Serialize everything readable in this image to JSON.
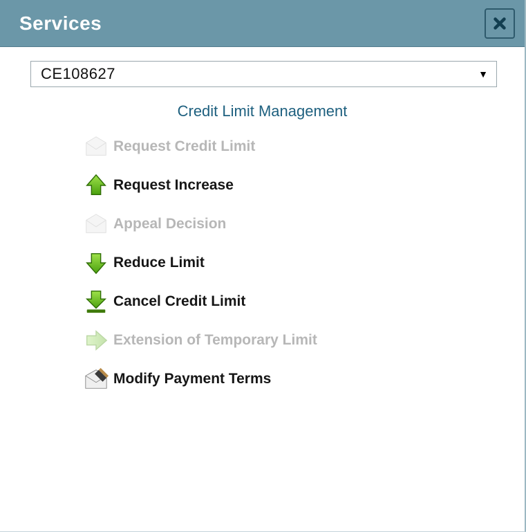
{
  "header": {
    "title": "Services"
  },
  "selector": {
    "value": "CE108627"
  },
  "section": {
    "title": "Credit Limit Management"
  },
  "items": [
    {
      "label": "Request Credit Limit",
      "icon": "envelope",
      "enabled": false
    },
    {
      "label": "Request Increase",
      "icon": "arrow-up",
      "enabled": true
    },
    {
      "label": "Appeal Decision",
      "icon": "envelope",
      "enabled": false
    },
    {
      "label": "Reduce Limit",
      "icon": "arrow-down",
      "enabled": true
    },
    {
      "label": "Cancel Credit Limit",
      "icon": "arrow-down-bar",
      "enabled": true
    },
    {
      "label": "Extension of Temporary Limit",
      "icon": "arrow-right",
      "enabled": false
    },
    {
      "label": "Modify Payment Terms",
      "icon": "envelope-pencil",
      "enabled": true
    }
  ]
}
